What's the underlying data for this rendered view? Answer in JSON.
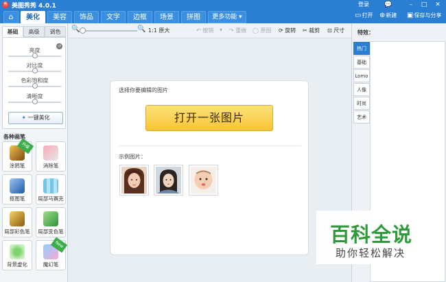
{
  "window": {
    "title": "美图秀秀 4.0.1",
    "logo": "秀",
    "login": "登录"
  },
  "window_controls": [
    "💬",
    "–",
    "□",
    "✕"
  ],
  "nav": {
    "home_icon": "⌂",
    "tabs": [
      "美化",
      "美容",
      "饰品",
      "文字",
      "边框",
      "场景",
      "拼图"
    ],
    "more": "更多功能 ▾",
    "open": "打开",
    "new": "新建",
    "save_share": "保存与分享"
  },
  "left_panel": {
    "subtabs": [
      "基础",
      "高级",
      "调色"
    ],
    "sliders": [
      {
        "label": "亮度",
        "value": 0.5
      },
      {
        "label": "对比度",
        "value": 0.5
      },
      {
        "label": "色彩饱和度",
        "value": 0.5
      },
      {
        "label": "清晰度",
        "value": 0.5
      }
    ],
    "one_key": "一键美化",
    "section_title": "各种画笔",
    "tools": [
      {
        "label": "涂鸦笔",
        "badge": "升级"
      },
      {
        "label": "消除笔"
      },
      {
        "label": "抠图笔"
      },
      {
        "label": "局部马赛克"
      },
      {
        "label": "局部彩色笔"
      },
      {
        "label": "局部变色笔"
      },
      {
        "label": "背景虚化"
      },
      {
        "label": "魔幻笔",
        "badge": "New"
      }
    ]
  },
  "toolbar": {
    "zoom_out": "🔍",
    "zoom_in": "🔍",
    "actual_size": "1:1 原大",
    "undo": "↶ 撤销",
    "redo": "↷ 重做",
    "original": "◯ 原图",
    "rotate": "⟳ 旋转",
    "crop": "✂ 裁剪",
    "resize": "⊡ 尺寸"
  },
  "canvas": {
    "choose_text": "选择你要编辑的图片",
    "open_button": "打开一张图片",
    "samples_label": "示例图片："
  },
  "right_panel": {
    "title": "特效：",
    "categories": [
      "热门",
      "基础",
      "Lomo",
      "人像",
      "时尚",
      "艺术"
    ]
  },
  "watermark": {
    "title": "百科全说",
    "subtitle": "助你轻松解决"
  }
}
